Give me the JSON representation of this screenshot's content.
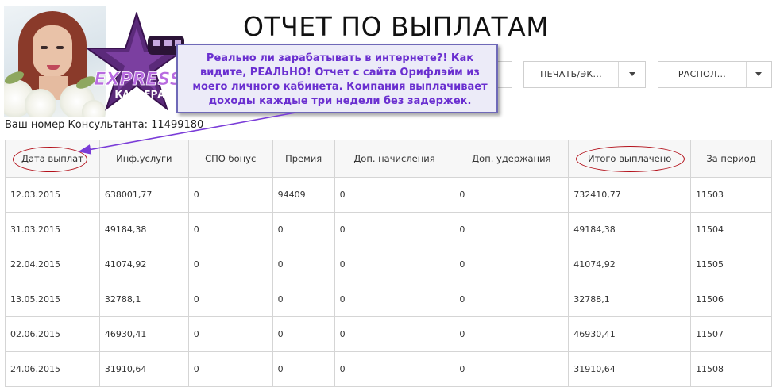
{
  "page": {
    "title": "ОТЧЕТ ПО ВЫПЛАТАМ"
  },
  "logo": {
    "text_main": "EXPRESS",
    "text_sub": "КАРЬЕРА",
    "star_color": "#5b2a7a",
    "text_color": "#a24ad0"
  },
  "callout": {
    "text": "Реально ли зарабатывать в интернете?! Как видите, РЕАЛЬНО! Отчет с сайта Орифлэйм из моего личного кабинета. Компания выплачивает доходы каждые три недели без задержек.",
    "color": "#6a2fd0"
  },
  "toolbar": {
    "print_label": "ПЕЧАТЬ/ЭК...",
    "layout_label": "РАСПОЛ..."
  },
  "consultant": {
    "label": "Ваш номер Консультанта: 11499180"
  },
  "table": {
    "headers": [
      "Дата выплат",
      "Инф.услуги",
      "СПО бонус",
      "Премия",
      "Доп. начисления",
      "Доп. удержания",
      "Итого выплачено",
      "За период"
    ],
    "rows": [
      [
        "12.03.2015",
        "638001,77",
        "0",
        "94409",
        "0",
        "0",
        "732410,77",
        "11503"
      ],
      [
        "31.03.2015",
        "49184,38",
        "0",
        "0",
        "0",
        "0",
        "49184,38",
        "11504"
      ],
      [
        "22.04.2015",
        "41074,92",
        "0",
        "0",
        "0",
        "0",
        "41074,92",
        "11505"
      ],
      [
        "13.05.2015",
        "32788,1",
        "0",
        "0",
        "0",
        "0",
        "32788,1",
        "11506"
      ],
      [
        "02.06.2015",
        "46930,41",
        "0",
        "0",
        "0",
        "0",
        "46930,41",
        "11507"
      ],
      [
        "24.06.2015",
        "31910,64",
        "0",
        "0",
        "0",
        "0",
        "31910,64",
        "11508"
      ]
    ]
  },
  "annotation": {
    "circle_color": "#b3101a",
    "arrow_color": "#7a3cd8"
  }
}
